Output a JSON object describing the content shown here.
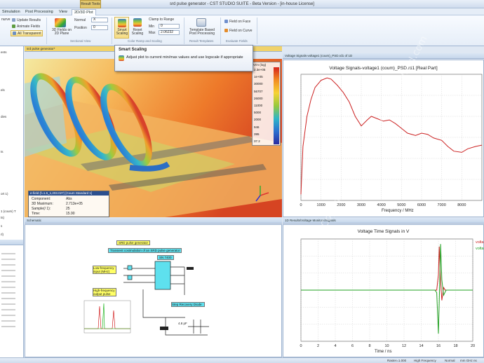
{
  "app": {
    "title": "srd pulse generator - CST STUDIO SUITE - Beta Version - [in-house License]",
    "context_tab": "Result Tools"
  },
  "menu": {
    "tabs": [
      "Simulation",
      "Post Processing",
      "View",
      "2D/3D Plot"
    ]
  },
  "ribbon": {
    "left_items": [
      "nurve",
      "Update Results",
      "Animate Fields",
      "All Transparent"
    ],
    "fields_on_plane": "3D Fields on 2D Plane",
    "normal_label": "Normal",
    "normal_value": "X",
    "position_label": "Position",
    "position_value": "0",
    "sectional_view": "Sectional View",
    "smart_scaling": "Smart Scaling",
    "reset_scaling": "Reset Scaling",
    "clamp_label": "Clamp to Range",
    "min_label": "Min",
    "min_value": "0",
    "max_label": "Max",
    "max_value": "2.06232",
    "color_ramp_group": "Color Ramp and Scaling",
    "template_btn": "Template Based Post Processing",
    "result_templates": "Result Templates",
    "field_on_face": "Field on Face",
    "field_on_curve": "Field on Curve",
    "evaluate_fields": "Evaluate Fields"
  },
  "tooltip": {
    "title": "Smart Scaling",
    "body": "Adjust plot to current min/max values and use logscale if appropriate"
  },
  "left_panel": {
    "rows": [
      "ents",
      "els",
      "dies",
      "ts",
      "ort 1)",
      "",
      "1 (coum) T",
      "ts)",
      "s",
      "rl)"
    ]
  },
  "view3d": {
    "tab": "srd pulse generator*",
    "legend_title": "V/m (log)",
    "legend_ticks": [
      "2.3e+05",
      "1e+05",
      "30000",
      "56707",
      "26000",
      "11000",
      "5000",
      "2000",
      "946",
      "395",
      "37.2"
    ],
    "info_title": "e-field (f=1.5_1,203.027) [Coum Standard 1]",
    "info": [
      [
        "Component:",
        "Abs"
      ],
      [
        "3D Maximum:",
        "2.713e+05"
      ],
      [
        "Sample(/ 1):",
        "25"
      ],
      [
        "Time:",
        "15.90"
      ]
    ]
  },
  "chart1_header": "Voltage Signals-voltage1 (coum)_PSD.rd1 of 1D",
  "chart2_header": "1D Results\\Voltage Monitors\\Signals",
  "schematic": {
    "header": "Schematic",
    "title": "SRD pulse generator",
    "subtitle": "Transient cosimulation of an SRD pulse generator",
    "lbl_low": "Low-frequency\ninput (MHz)",
    "lbl_high": "High-frequency\noutput pulse",
    "lbl_step": "Step Recovery Diode",
    "lbl_ic": "SN 7400",
    "lbl_cap": "4.8 pF"
  },
  "status": {
    "raster": "Raster=1.000",
    "freq": "High Frequency",
    "mode": "Normal",
    "units": "mm GHz ns"
  },
  "watermark": "Copyright © 2019 - www.p30download.com",
  "chart_data": [
    {
      "type": "line",
      "title": "Voltage Signals-voltage1 (coum)_PSD.rd1 [Real Part]",
      "xlabel": "Frequency / MHz",
      "xlim": [
        0,
        9000
      ],
      "xticks": [
        0,
        1000,
        2000,
        3000,
        4000,
        5000,
        6000,
        7000,
        8000
      ],
      "series": [
        {
          "color": "#cc2222",
          "x": [
            0,
            100,
            300,
            500,
            700,
            1000,
            1300,
            1500,
            1800,
            2100,
            2400,
            2700,
            3000,
            3300,
            3500,
            3800,
            4100,
            4400,
            4700,
            5000,
            5300,
            5700,
            6000,
            6300,
            6600,
            7000,
            7300,
            7600,
            8000,
            8300,
            8700,
            9000
          ],
          "y": [
            -0.95,
            -0.55,
            -0.3,
            -0.16,
            -0.06,
            0.0,
            0.02,
            0.01,
            -0.04,
            -0.1,
            -0.18,
            -0.3,
            -0.38,
            -0.33,
            -0.3,
            -0.32,
            -0.34,
            -0.33,
            -0.36,
            -0.4,
            -0.44,
            -0.46,
            -0.44,
            -0.45,
            -0.48,
            -0.5,
            -0.55,
            -0.59,
            -0.6,
            -0.57,
            -0.55,
            -0.54
          ]
        }
      ]
    },
    {
      "type": "line",
      "title": "Voltage Time Signals in V",
      "xlabel": "Time / ns",
      "xlim": [
        0,
        20
      ],
      "xticks": [
        0,
        2,
        4,
        6,
        8,
        10,
        12,
        14,
        16,
        18,
        20
      ],
      "series": [
        {
          "name": "volta",
          "color": "#cc2222",
          "x": [
            0,
            15.8,
            16.0,
            16.1,
            16.25,
            16.4,
            16.6,
            16.8,
            20
          ],
          "y": [
            0,
            0,
            0.3,
            0.85,
            0.2,
            -0.2,
            0.05,
            0,
            0
          ]
        },
        {
          "name": "volta",
          "color": "#22a022",
          "x": [
            0,
            15.6,
            15.8,
            16.0,
            16.15,
            16.25,
            16.4,
            16.6,
            16.9,
            20
          ],
          "y": [
            0,
            0,
            -0.05,
            -0.85,
            0.1,
            0.9,
            0.2,
            -0.1,
            0,
            0
          ]
        }
      ]
    }
  ]
}
